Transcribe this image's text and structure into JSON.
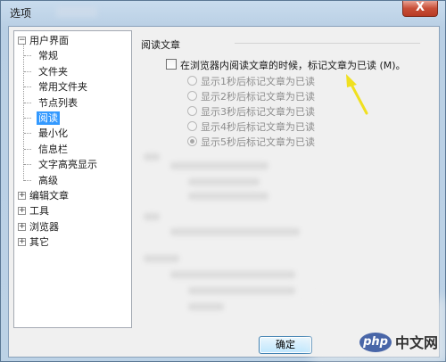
{
  "window": {
    "title": "选项",
    "close_glyph": "X"
  },
  "tree": {
    "items": [
      {
        "label": "用户界面",
        "expander": "−"
      },
      {
        "label": "常规"
      },
      {
        "label": "文件夹"
      },
      {
        "label": "常用文件夹"
      },
      {
        "label": "节点列表"
      },
      {
        "label": "阅读",
        "selected": true
      },
      {
        "label": "最小化"
      },
      {
        "label": "信息栏"
      },
      {
        "label": "文字高亮显示"
      },
      {
        "label": "高级"
      },
      {
        "label": "编辑文章",
        "expander": "+"
      },
      {
        "label": "工具",
        "expander": "+"
      },
      {
        "label": "浏览器",
        "expander": "+"
      },
      {
        "label": "其它",
        "expander": "+"
      }
    ]
  },
  "pane": {
    "group_title": "阅读文章",
    "mark_read_checkbox": {
      "label": "在浏览器内阅读文章的时候，标记文章为已读 (M)。",
      "checked": false
    },
    "radio_options": [
      {
        "label": "显示1秒后标记文章为已读",
        "checked": false
      },
      {
        "label": "显示2秒后标记文章为已读",
        "checked": false
      },
      {
        "label": "显示3秒后标记文章为已读",
        "checked": false
      },
      {
        "label": "显示4秒后标记文章为已读",
        "checked": false
      },
      {
        "label": "显示5秒后标记文章为已读",
        "checked": true
      }
    ]
  },
  "buttons": {
    "ok": "确定"
  },
  "watermark": {
    "logo": "php",
    "text": "中文网"
  },
  "colors": {
    "selection": "#3399ff",
    "arrow": "#f0e020"
  }
}
